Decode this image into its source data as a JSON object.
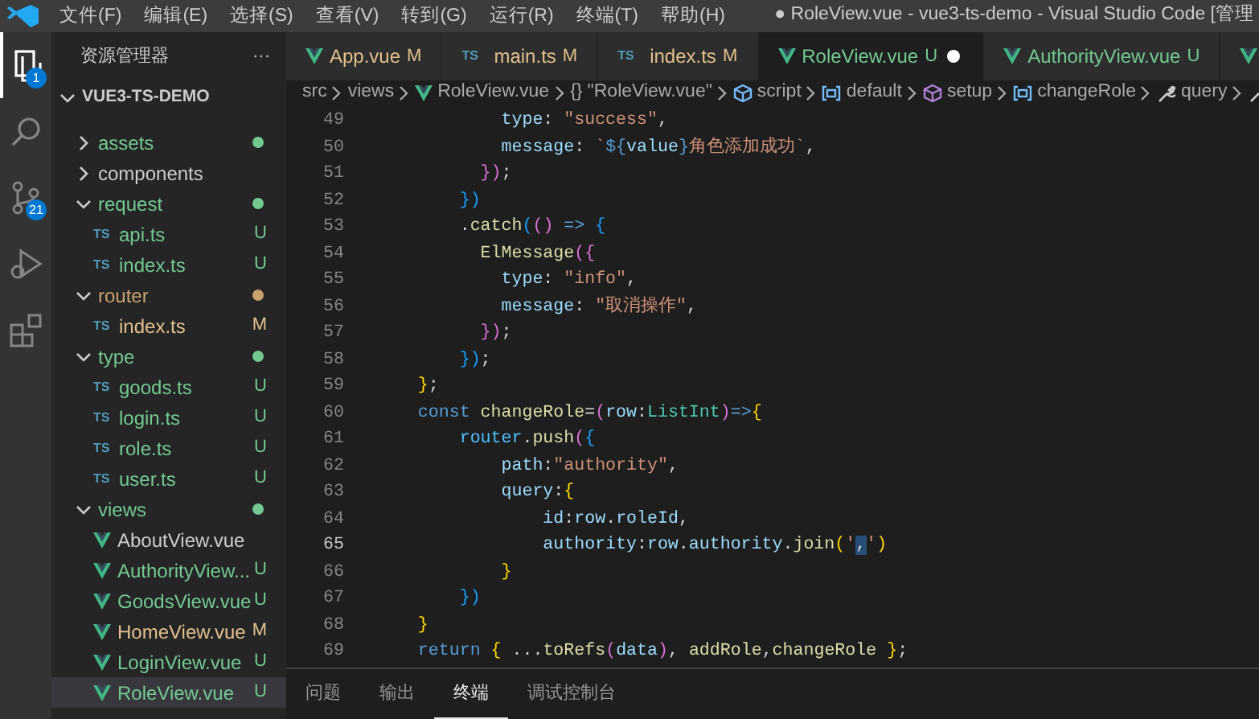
{
  "window": {
    "title": "● RoleView.vue - vue3-ts-demo - Visual Studio Code [管理"
  },
  "menu": [
    "文件(F)",
    "编辑(E)",
    "选择(S)",
    "查看(V)",
    "转到(G)",
    "运行(R)",
    "终端(T)",
    "帮助(H)"
  ],
  "activity_bar": [
    {
      "kind": "explorer",
      "selected": true,
      "badge": "1"
    },
    {
      "kind": "search",
      "selected": false
    },
    {
      "kind": "scm",
      "selected": false,
      "badge": "21"
    },
    {
      "kind": "debug",
      "selected": false
    },
    {
      "kind": "extensions",
      "selected": false
    }
  ],
  "sidebar": {
    "title": "资源管理器",
    "more": "···",
    "root": {
      "label": "VUE3-TS-DEMO",
      "expanded": true
    },
    "items": [
      {
        "label": "assets",
        "kind": "folder",
        "expanded": false,
        "color": "#73c991"
      },
      {
        "label": "components",
        "kind": "folder",
        "expanded": false
      },
      {
        "label": "request",
        "kind": "folder",
        "expanded": true,
        "color": "#73c991",
        "children": [
          {
            "label": "api.ts",
            "kind": "ts",
            "icon_label": "TS",
            "status": "U",
            "selected": false
          },
          {
            "label": "index.ts",
            "kind": "ts",
            "icon_label": "TS",
            "status": "U",
            "selected": false
          }
        ]
      },
      {
        "label": "router",
        "kind": "folder",
        "expanded": true,
        "color": "#c9a26d",
        "children": [
          {
            "label": "index.ts",
            "kind": "ts",
            "icon_label": "TS",
            "status": "M",
            "selected": false
          }
        ]
      },
      {
        "label": "type",
        "kind": "folder",
        "expanded": true,
        "color": "#73c991",
        "children": [
          {
            "label": "goods.ts",
            "kind": "ts",
            "icon_label": "TS",
            "status": "U",
            "selected": false
          },
          {
            "label": "login.ts",
            "kind": "ts",
            "icon_label": "TS",
            "status": "U",
            "selected": false
          },
          {
            "label": "role.ts",
            "kind": "ts",
            "icon_label": "TS",
            "status": "U",
            "selected": false
          },
          {
            "label": "user.ts",
            "kind": "ts",
            "icon_label": "TS",
            "status": "U",
            "selected": false
          }
        ]
      },
      {
        "label": "views",
        "kind": "folder",
        "expanded": true,
        "color": "#73c991",
        "children": [
          {
            "label": "AboutView.vue",
            "kind": "vue",
            "selected": false
          },
          {
            "label": "AuthorityView...",
            "kind": "vue",
            "status": "U",
            "selected": false
          },
          {
            "label": "GoodsView.vue",
            "kind": "vue",
            "status": "U",
            "selected": false
          },
          {
            "label": "HomeView.vue",
            "kind": "vue",
            "status": "M",
            "selected": false
          },
          {
            "label": "LoginView.vue",
            "kind": "vue",
            "status": "U",
            "selected": false
          },
          {
            "label": "RoleView.vue",
            "kind": "vue",
            "status": "U",
            "selected": true
          }
        ]
      }
    ]
  },
  "tabs": [
    {
      "label": "App.vue",
      "kind": "vue",
      "status": "M",
      "selected": false,
      "dirty": false
    },
    {
      "label": "main.ts",
      "kind": "ts",
      "icon_label": "TS",
      "status": "M",
      "selected": false,
      "dirty": false
    },
    {
      "label": "index.ts",
      "kind": "ts",
      "icon_label": "TS",
      "status": "M",
      "selected": false,
      "dirty": false
    },
    {
      "label": "RoleView.vue",
      "kind": "vue",
      "status": "U",
      "selected": true,
      "dirty": true
    },
    {
      "label": "AuthorityView.vue",
      "kind": "vue",
      "status": "U",
      "selected": false,
      "dirty": false
    },
    {
      "kind": "vue",
      "selected": false,
      "dirty": false
    }
  ],
  "breadcrumb": [
    {
      "label": "src",
      "kind": "text"
    },
    {
      "label": "views",
      "kind": "text"
    },
    {
      "label": "RoleView.vue",
      "kind": "vue"
    },
    {
      "label": "\"RoleView.vue\"",
      "kind": "braces",
      "symbol": "{}"
    },
    {
      "label": "script",
      "kind": "module"
    },
    {
      "label": "default",
      "kind": "variable"
    },
    {
      "label": "setup",
      "kind": "method"
    },
    {
      "label": "changeRole",
      "kind": "variable"
    },
    {
      "label": "query",
      "kind": "property"
    },
    {
      "kind": "property"
    }
  ],
  "code": [
    {
      "number": "49",
      "current": false,
      "tokens": [
        {
          "text": "            type",
          "kind": "v"
        },
        {
          "text": ": ",
          "kind": "p"
        },
        {
          "text": "\"success\"",
          "kind": "s"
        },
        {
          "text": ",",
          "kind": "p"
        }
      ]
    },
    {
      "number": "50",
      "current": false,
      "tokens": [
        {
          "text": "            message",
          "kind": "v"
        },
        {
          "text": ": ",
          "kind": "p"
        },
        {
          "text": "`",
          "kind": "s"
        },
        {
          "text": "${",
          "kind": "k"
        },
        {
          "text": "value",
          "kind": "v"
        },
        {
          "text": "}",
          "kind": "k"
        },
        {
          "text": "角色添加成功`",
          "kind": "s"
        },
        {
          "text": ",",
          "kind": "p"
        }
      ]
    },
    {
      "number": "51",
      "current": false,
      "tokens": [
        {
          "text": "          })",
          "kind": "b2"
        },
        {
          "text": ";",
          "kind": "p"
        }
      ]
    },
    {
      "number": "52",
      "current": false,
      "tokens": [
        {
          "text": "        })",
          "kind": "b3"
        }
      ]
    },
    {
      "number": "53",
      "current": false,
      "tokens": [
        {
          "text": "        .",
          "kind": "p"
        },
        {
          "text": "catch",
          "kind": "f"
        },
        {
          "text": "(",
          "kind": "b3"
        },
        {
          "text": "()",
          "kind": "b2"
        },
        {
          "text": " => ",
          "kind": "k"
        },
        {
          "text": "{",
          "kind": "b3"
        }
      ]
    },
    {
      "number": "54",
      "current": false,
      "tokens": [
        {
          "text": "          ElMessage",
          "kind": "f"
        },
        {
          "text": "({",
          "kind": "b2"
        }
      ]
    },
    {
      "number": "55",
      "current": false,
      "tokens": [
        {
          "text": "            type",
          "kind": "v"
        },
        {
          "text": ": ",
          "kind": "p"
        },
        {
          "text": "\"info\"",
          "kind": "s"
        },
        {
          "text": ",",
          "kind": "p"
        }
      ]
    },
    {
      "number": "56",
      "current": false,
      "tokens": [
        {
          "text": "            message",
          "kind": "v"
        },
        {
          "text": ": ",
          "kind": "p"
        },
        {
          "text": "\"取消操作\"",
          "kind": "s"
        },
        {
          "text": ",",
          "kind": "p"
        }
      ]
    },
    {
      "number": "57",
      "current": false,
      "tokens": [
        {
          "text": "          })",
          "kind": "b2"
        },
        {
          "text": ";",
          "kind": "p"
        }
      ]
    },
    {
      "number": "58",
      "current": false,
      "tokens": [
        {
          "text": "        })",
          "kind": "b3"
        },
        {
          "text": ";",
          "kind": "p"
        }
      ]
    },
    {
      "number": "59",
      "current": false,
      "tokens": [
        {
          "text": "    }",
          "kind": "b1"
        },
        {
          "text": ";",
          "kind": "p"
        }
      ]
    },
    {
      "number": "60",
      "current": false,
      "tokens": [
        {
          "text": "    const",
          "kind": "k"
        },
        {
          "text": " changeRole",
          "kind": "f"
        },
        {
          "text": "=",
          "kind": "p"
        },
        {
          "text": "(",
          "kind": "b2"
        },
        {
          "text": "row",
          "kind": "v"
        },
        {
          "text": ":",
          "kind": "p"
        },
        {
          "text": "ListInt",
          "kind": "t"
        },
        {
          "text": ")",
          "kind": "b2"
        },
        {
          "text": "=>",
          "kind": "k"
        },
        {
          "text": "{",
          "kind": "b1"
        }
      ]
    },
    {
      "number": "61",
      "current": false,
      "tokens": [
        {
          "text": "        router",
          "kind": "c"
        },
        {
          "text": ".",
          "kind": "p"
        },
        {
          "text": "push",
          "kind": "f"
        },
        {
          "text": "(",
          "kind": "b2"
        },
        {
          "text": "{",
          "kind": "b3"
        }
      ]
    },
    {
      "number": "62",
      "current": false,
      "tokens": [
        {
          "text": "            path",
          "kind": "v"
        },
        {
          "text": ":",
          "kind": "p"
        },
        {
          "text": "\"authority\"",
          "kind": "s"
        },
        {
          "text": ",",
          "kind": "p"
        }
      ]
    },
    {
      "number": "63",
      "current": false,
      "tokens": [
        {
          "text": "            query",
          "kind": "v"
        },
        {
          "text": ":",
          "kind": "p"
        },
        {
          "text": "{",
          "kind": "b1"
        }
      ]
    },
    {
      "number": "64",
      "current": false,
      "tokens": [
        {
          "text": "                id",
          "kind": "v"
        },
        {
          "text": ":",
          "kind": "p"
        },
        {
          "text": "row",
          "kind": "v"
        },
        {
          "text": ".",
          "kind": "p"
        },
        {
          "text": "roleId",
          "kind": "v"
        },
        {
          "text": ",",
          "kind": "p"
        }
      ]
    },
    {
      "number": "65",
      "current": true,
      "tokens": [
        {
          "text": "                authority",
          "kind": "v"
        },
        {
          "text": ":",
          "kind": "p"
        },
        {
          "text": "row",
          "kind": "v"
        },
        {
          "text": ".",
          "kind": "p"
        },
        {
          "text": "authority",
          "kind": "v"
        },
        {
          "text": ".",
          "kind": "p"
        },
        {
          "text": "join",
          "kind": "f"
        },
        {
          "text": "(",
          "kind": "b1"
        },
        {
          "text": "'",
          "kind": "s"
        },
        {
          "text": ",",
          "kind": "sel"
        },
        {
          "text": "'",
          "kind": "s"
        },
        {
          "text": ")",
          "kind": "b1"
        }
      ]
    },
    {
      "number": "66",
      "current": false,
      "tokens": [
        {
          "text": "            }",
          "kind": "b1"
        }
      ]
    },
    {
      "number": "67",
      "current": false,
      "tokens": [
        {
          "text": "        })",
          "kind": "b3"
        }
      ]
    },
    {
      "number": "68",
      "current": false,
      "tokens": [
        {
          "text": "    }",
          "kind": "b1"
        }
      ]
    },
    {
      "number": "69",
      "current": false,
      "tokens": [
        {
          "text": "    return",
          "kind": "k"
        },
        {
          "text": " { ",
          "kind": "b1"
        },
        {
          "text": "...",
          "kind": "p"
        },
        {
          "text": "toRefs",
          "kind": "f"
        },
        {
          "text": "(",
          "kind": "b2"
        },
        {
          "text": "data",
          "kind": "v"
        },
        {
          "text": ")",
          "kind": "b2"
        },
        {
          "text": ", ",
          "kind": "p"
        },
        {
          "text": "addRole",
          "kind": "f"
        },
        {
          "text": ",",
          "kind": "p"
        },
        {
          "text": "changeRole",
          "kind": "f"
        },
        {
          "text": " }",
          "kind": "b1"
        },
        {
          "text": ";",
          "kind": "p"
        }
      ]
    }
  ],
  "panel_tabs": [
    {
      "label": "问题",
      "selected": false
    },
    {
      "label": "输出",
      "selected": false
    },
    {
      "label": "终端",
      "selected": true
    },
    {
      "label": "调试控制台",
      "selected": false
    }
  ]
}
